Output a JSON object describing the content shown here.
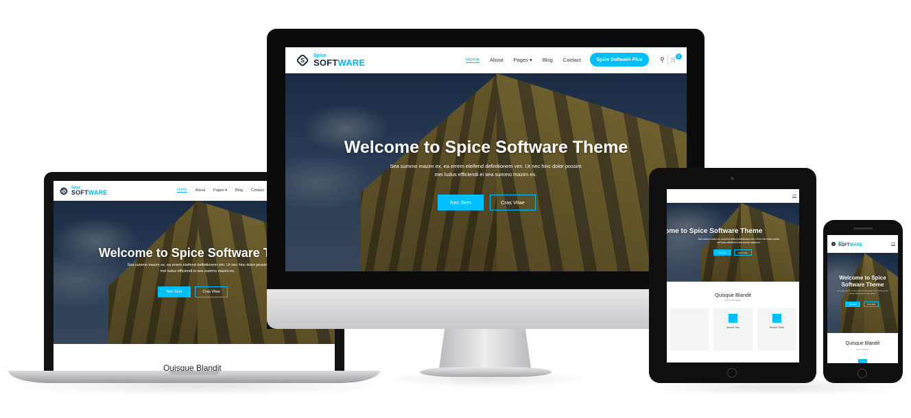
{
  "site": {
    "logo_small": "Spice",
    "logo_main": "SOFT",
    "logo_accent": "WARE",
    "menu": [
      "Home",
      "About",
      "Pages",
      "Blog",
      "Contact"
    ],
    "cta_button": "Spice Software Plus",
    "cart_count": "0",
    "hero_title": "Welcome to Spice Software Theme",
    "hero_title_line1": "Welcome to Spice",
    "hero_title_line2": "Software Theme",
    "hero_subtitle_line1": "Sea summo mazim ex, ea errem eleifend definitionem vim. Ut nec hinc dolor possim",
    "hero_subtitle_line2": "mei ludus efficiendi ei sea summo mazim ex.",
    "primary_button": "Nec Sem",
    "secondary_button": "Cras Vitae",
    "section_title": "Quisque Blandit",
    "section_subtitle": "Fusce Vel Massa",
    "services": [
      "Service Two",
      "Service Three"
    ]
  },
  "colors": {
    "accent": "#00bfff",
    "brand_dark": "#1c2b44"
  }
}
